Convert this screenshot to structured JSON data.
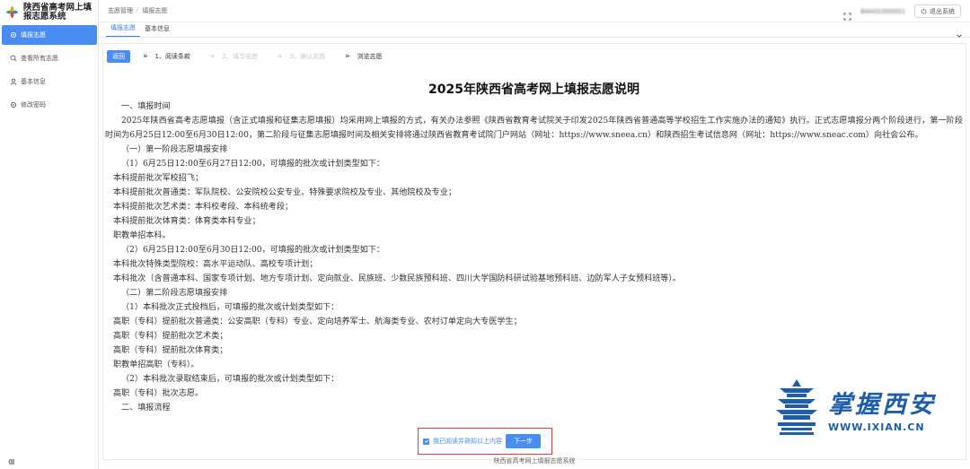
{
  "app": {
    "title_line1": "陕西省高考网上填",
    "title_line2": "报志愿系统"
  },
  "sidebar": {
    "items": [
      {
        "label": "填报志愿",
        "icon": "gear-icon",
        "active": true
      },
      {
        "label": "查看所有志愿",
        "icon": "search-icon",
        "active": false
      },
      {
        "label": "基本信息",
        "icon": "user-icon",
        "active": false
      },
      {
        "label": "修改密码",
        "icon": "gear-icon",
        "active": false
      }
    ]
  },
  "header": {
    "breadcrumb": [
      "志愿管理",
      "/",
      "填报志愿"
    ],
    "user": "B4A01000001",
    "logout_label": "退出系统"
  },
  "tabs": [
    {
      "label": "填报志愿",
      "active": true
    },
    {
      "label": "基本信息",
      "active": false
    }
  ],
  "steps": {
    "back_label": "返回",
    "items": [
      {
        "label": "1、阅读条款",
        "state": "on"
      },
      {
        "label": "2、填写志愿",
        "state": "off"
      },
      {
        "label": "3、确认志愿",
        "state": "off"
      },
      {
        "label": "浏览志愿",
        "state": "on"
      }
    ]
  },
  "doc": {
    "title": "2025年陕西省高考网上填报志愿说明",
    "p1": "一、填报时间",
    "p2": "2025年陕西省高考志愿填报（含正式填报和征集志愿填报）均采用网上填报的方式，有关办法参照《陕西省教育考试院关于印发2025年陕西省普通高等学校招生工作实施办法的通知》执行。正式志愿填报分两个阶段进行，第一阶段时间为6月25日12:00至6月30日12:00，第二阶段与征集志愿填报时间及相关安排将通过陕西省教育考试院门户网站（网址：https://www.sneea.cn）和陕西招生考试信息网（网址：https://www.sneac.com）向社会公布。",
    "p3": "（一）第一阶段志愿填报安排",
    "p4": "（1）6月25日12:00至6月27日12:00，可填报的批次或计划类型如下：",
    "p5": "本科提前批次军校招飞；",
    "p6": "本科提前批次普通类：军队院校、公安院校公安专业、特殊要求院校及专业、其他院校及专业；",
    "p7": "本科提前批次艺术类：本科校考段、本科统考段；",
    "p8": "本科提前批次体育类：体育类本科专业；",
    "p9": "职教单招本科。",
    "p10": "（2）6月25日12:00至6月30日12:00，可填报的批次或计划类型如下：",
    "p11": "本科批次特殊类型院校：高水平运动队、高校专项计划；",
    "p12": "本科批次（含普通本科、国家专项计划、地方专项计划、定向就业、民族班、少数民族预科班、四川大学国防科研试验基地预科班、边防军人子女预科班等）。",
    "p13": "（二）第二阶段志愿填报安排",
    "p14": "（1）本科批次正式投档后，可填报的批次或计划类型如下：",
    "p15": "高职（专科）提前批次普通类：公安高职（专科）专业、定向培养军士、航海类专业、农村订单定向大专医学生；",
    "p16": "高职（专科）提前批次艺术类；",
    "p17": "高职（专科）提前批次体育类；",
    "p18": "职教单招高职（专科）。",
    "p19": "（2）本科批次录取结束后，可填报的批次或计划类型如下：",
    "p20": "高职（专科）批次志愿。",
    "p21": "二、填报流程"
  },
  "confirm": {
    "checkbox_label": "我已阅读并熟知以上内容",
    "checked": true,
    "next_label": "下一步"
  },
  "footer": {
    "text": "陕西省高考网上填报志愿系统"
  },
  "watermark": {
    "cn": "掌握西安",
    "en": "WWW.IXIAN.CN"
  },
  "colors": {
    "accent": "#4a8df0",
    "highlight_border": "#e23b3b",
    "watermark": "#1e5ea8"
  }
}
